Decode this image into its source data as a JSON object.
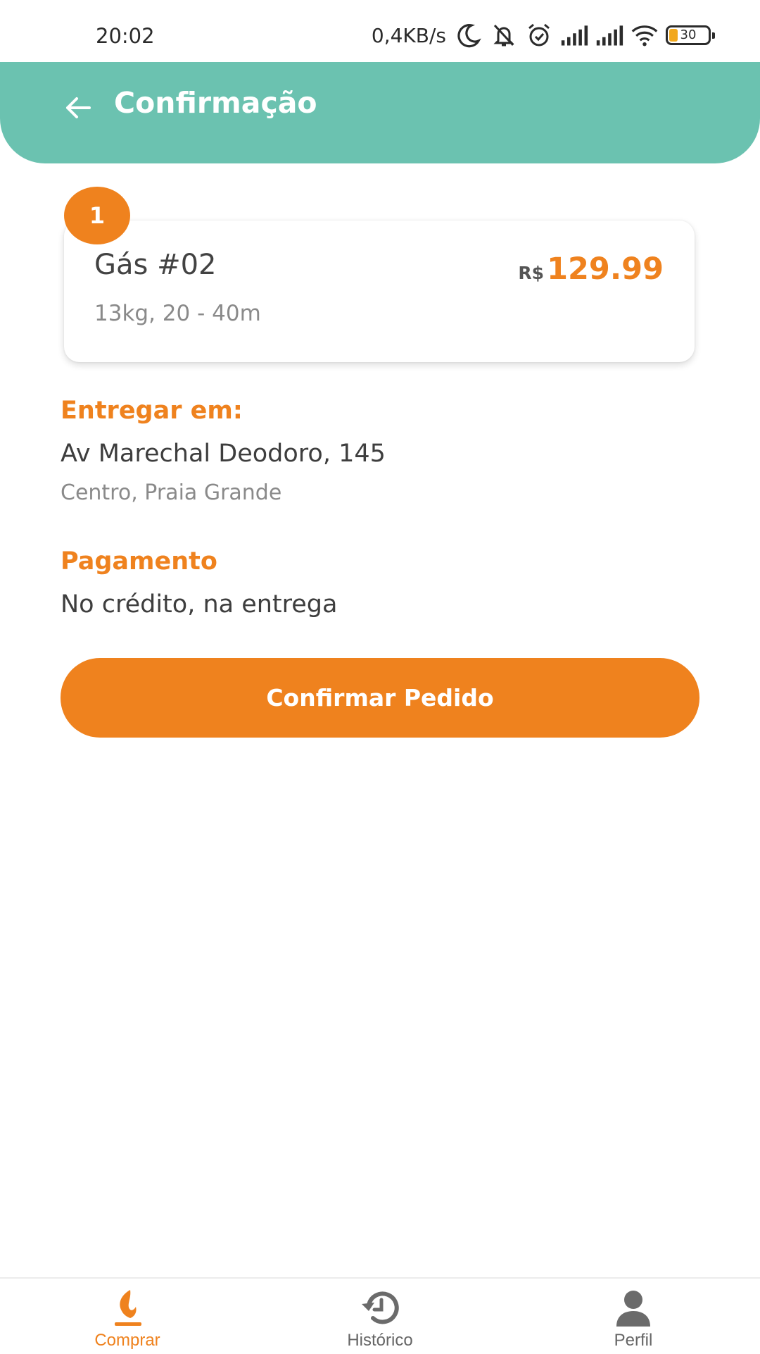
{
  "status_bar": {
    "time": "20:02",
    "network_speed": "0,4KB/s",
    "battery_level": "30",
    "icons": [
      "moon-icon",
      "bell-muted-icon",
      "alarm-icon",
      "signal-icon",
      "signal-icon",
      "wifi-icon",
      "battery-icon"
    ]
  },
  "header": {
    "title": "Confirmação",
    "back_icon": "arrow-left-icon",
    "background": "#6bc2b0"
  },
  "order_item": {
    "quantity": "1",
    "name": "Gás #02",
    "details": "13kg, 20 - 40m",
    "currency": "R$",
    "price": "129.99"
  },
  "delivery": {
    "label": "Entregar em:",
    "address_line1": "Av Marechal Deodoro, 145",
    "address_line2": "Centro, Praia Grande"
  },
  "payment": {
    "label": "Pagamento",
    "method": "No crédito, na entrega"
  },
  "actions": {
    "confirm_label": "Confirmar Pedido"
  },
  "bottom_nav": {
    "items": [
      {
        "label": "Comprar",
        "icon": "flame-icon",
        "active": true
      },
      {
        "label": "Histórico",
        "icon": "history-icon",
        "active": false
      },
      {
        "label": "Perfil",
        "icon": "user-icon",
        "active": false
      }
    ]
  },
  "colors": {
    "accent": "#ef821e",
    "header": "#6bc2b0",
    "text": "#424242",
    "muted": "#8a8a8a"
  }
}
